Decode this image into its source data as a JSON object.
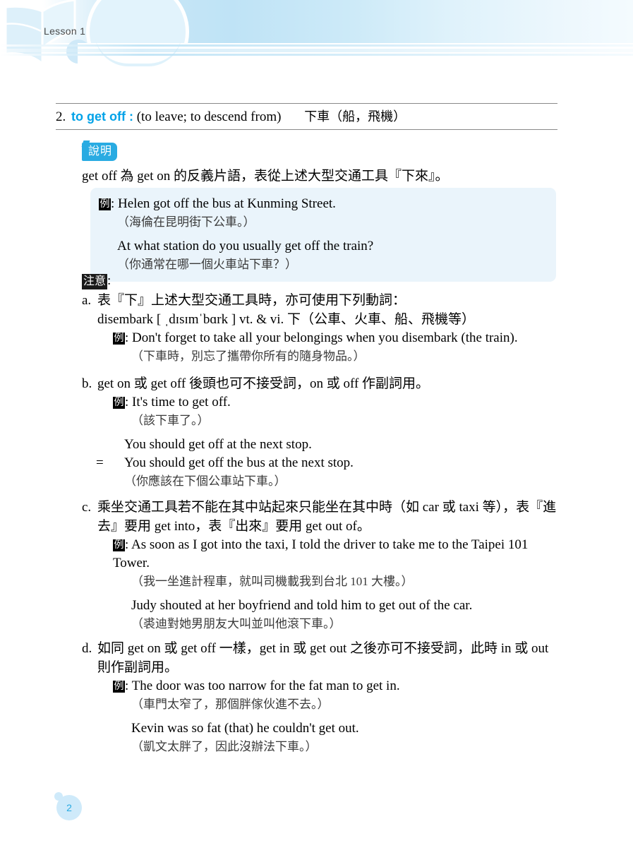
{
  "header": {
    "lesson_label": "Lesson 1",
    "book_icon": "open-book-icon",
    "band_color": "#c9e7f7",
    "accent_color": "#29ABE2"
  },
  "entry": {
    "number": "2.",
    "phrase": "to get off :",
    "english_definition": "(to leave; to descend from)",
    "chinese_definition": "下車（船，飛機）",
    "phrase_color": "#00a2e8"
  },
  "explanation": {
    "badge_label": "說明",
    "text": "get off 為 get on 的反義片語，表從上述大型交通工具『下來』。"
  },
  "example_box": {
    "marker": "例",
    "items": [
      {
        "en": "Helen got off the bus at Kunming Street.",
        "cn": "（海倫在昆明街下公車。）"
      },
      {
        "en": "At what station do you usually get off the train?",
        "cn": "（你通常在哪一個火車站下車？）"
      }
    ],
    "background": "#eaf4fb"
  },
  "notes": {
    "badge_label": "注意",
    "badge_colon": ":",
    "items": [
      {
        "label": "a.",
        "body": "表『下』上述大型交通工具時，亦可使用下列動詞：",
        "sub_line": "disembark [ ˌdɪsɪmˈbɑrk ] vt. & vi. 下（公車、火車、船、飛機等）",
        "examples": [
          {
            "marker": "例",
            "en": "Don't forget to take all your belongings when you disembark (the train).",
            "cn": "（下車時，別忘了攜帶你所有的隨身物品。）"
          }
        ]
      },
      {
        "label": "b.",
        "body": "get on 或 get off 後頭也可不接受詞，on 或 off 作副詞用。",
        "examples": [
          {
            "marker": "例",
            "en": "It's time to get off.",
            "cn": "（該下車了。）"
          }
        ],
        "equation": {
          "line1": "You should get off at the next stop.",
          "eq_sign": "=",
          "line2": "You should get off the bus at the next stop.",
          "cn": "（你應該在下個公車站下車。）"
        }
      },
      {
        "label": "c.",
        "body": "乘坐交通工具若不能在其中站起來只能坐在其中時（如 car 或 taxi 等），表『進去』要用 get into，表『出來』要用 get out of。",
        "examples": [
          {
            "marker": "例",
            "en": "As soon as I got into the taxi, I told the driver to take me to the Taipei 101 Tower.",
            "cn": "（我一坐進計程車，就叫司機載我到台北 101 大樓。）"
          },
          {
            "marker": "",
            "en": "Judy shouted at her boyfriend and told him to get out of the car.",
            "cn": "（裘迪對她男朋友大叫並叫他滾下車。）"
          }
        ]
      },
      {
        "label": "d.",
        "body": "如同 get on 或 get off 一樣，get in 或 get out 之後亦可不接受詞，此時 in 或 out 則作副詞用。",
        "examples": [
          {
            "marker": "例",
            "en": "The door was too narrow for the fat man to get in.",
            "cn": "（車門太窄了，那個胖傢伙進不去。）"
          },
          {
            "marker": "",
            "en": "Kevin was so fat (that) he couldn't get out.",
            "cn": "（凱文太胖了，因此沒辦法下車。）"
          }
        ]
      }
    ]
  },
  "footer": {
    "page_number": "2",
    "circle_color": "#cfeafa",
    "number_color": "#29ABE2"
  }
}
